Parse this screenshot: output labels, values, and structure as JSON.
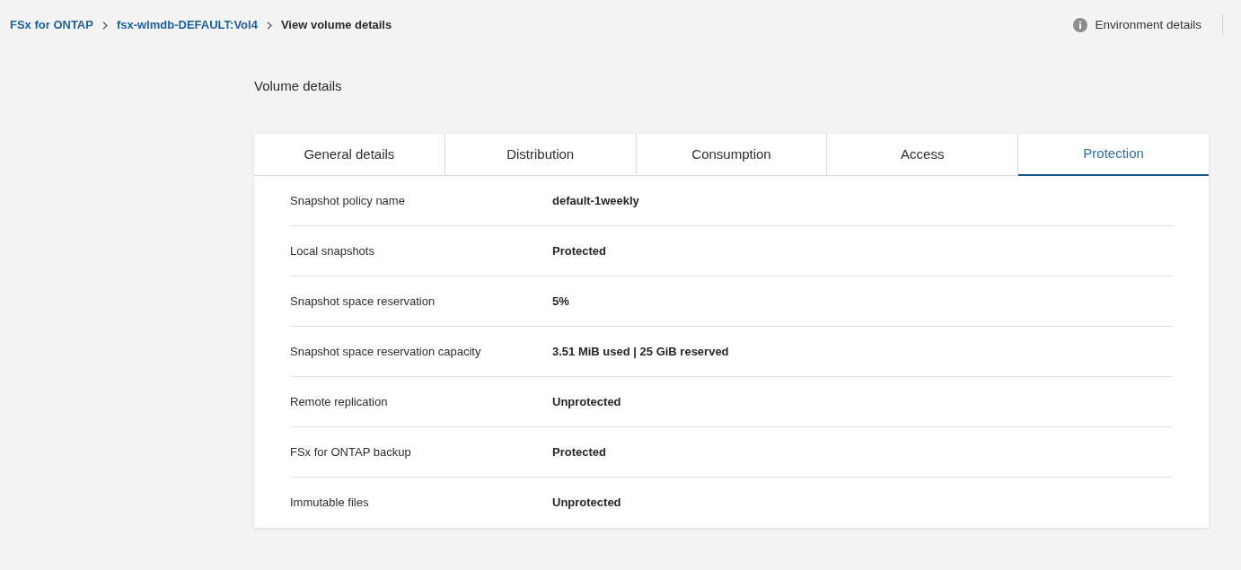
{
  "breadcrumb": [
    {
      "label": "FSx for ONTAP",
      "kind": "link"
    },
    {
      "label": "fsx-wlmdb-DEFAULT:Vol4",
      "kind": "link"
    },
    {
      "label": "View volume details",
      "kind": "current"
    }
  ],
  "header_action": {
    "label": "Environment details"
  },
  "page_title": "Volume details",
  "tabs": [
    {
      "label": "General details",
      "selected": false
    },
    {
      "label": "Distribution",
      "selected": false
    },
    {
      "label": "Consumption",
      "selected": false
    },
    {
      "label": "Access",
      "selected": false
    },
    {
      "label": "Protection",
      "selected": true
    }
  ],
  "details": [
    {
      "label": "Snapshot policy name",
      "value": "default-1weekly"
    },
    {
      "label": "Local snapshots",
      "value": "Protected"
    },
    {
      "label": "Snapshot space reservation",
      "value": "5%"
    },
    {
      "label": "Snapshot space reservation capacity",
      "value": "3.51 MiB used | 25 GiB reserved"
    },
    {
      "label": "Remote replication",
      "value": "Unprotected"
    },
    {
      "label": "FSx for ONTAP backup",
      "value": "Protected"
    },
    {
      "label": "Immutable files",
      "value": "Unprotected"
    }
  ]
}
